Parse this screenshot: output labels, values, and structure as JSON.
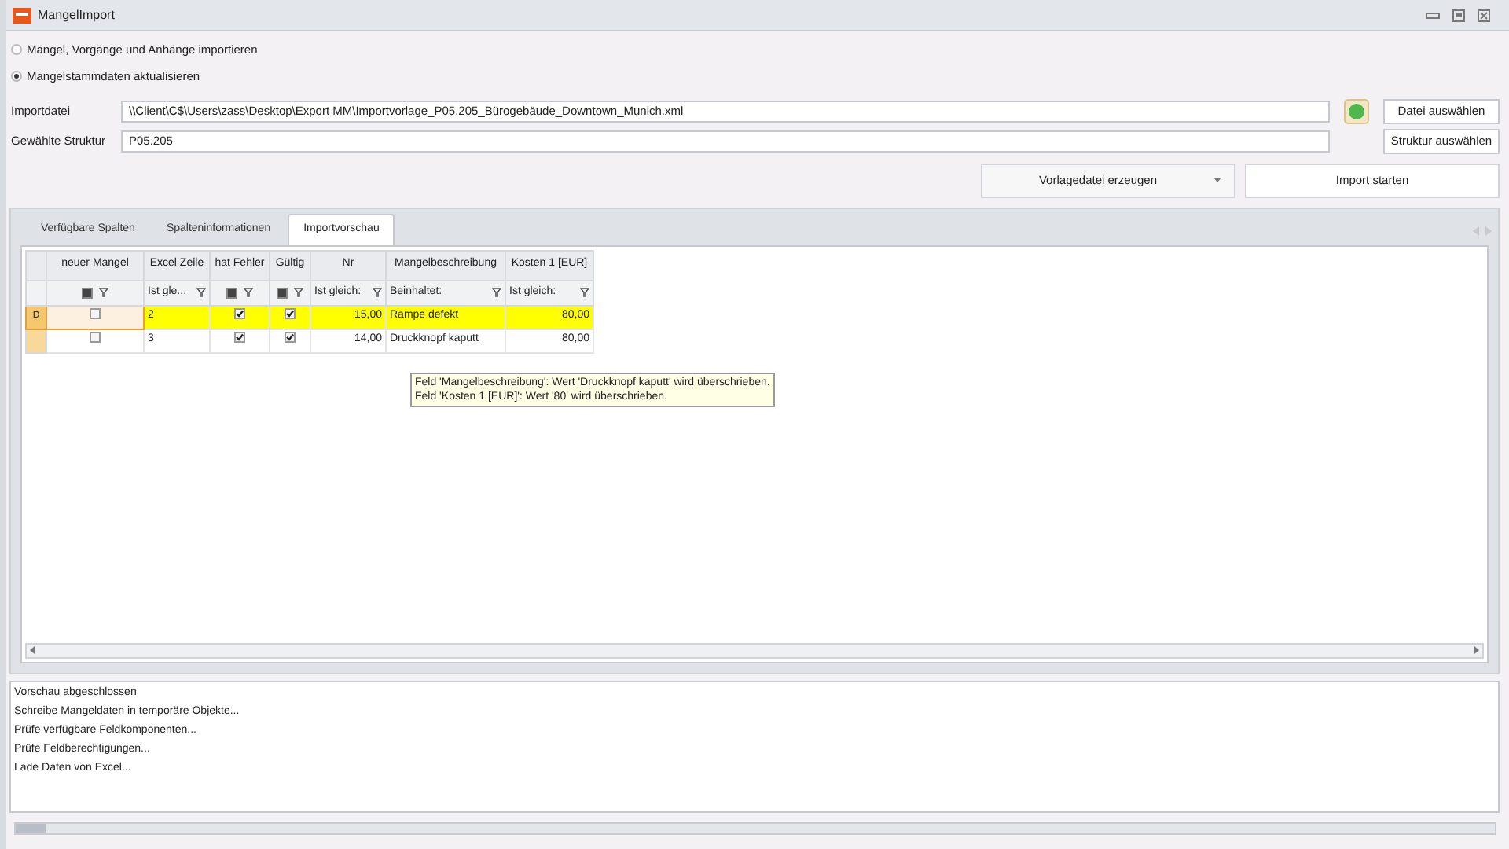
{
  "window": {
    "title": "MangelImport"
  },
  "modes": [
    {
      "label": "Mängel, Vorgänge und Anhänge importieren",
      "selected": false
    },
    {
      "label": "Mangelstammdaten aktualisieren",
      "selected": true
    }
  ],
  "import_file": {
    "label": "Importdatei",
    "value": "\\\\Client\\C$\\Users\\zass\\Desktop\\Export MM\\Importvorlage_P05.205_Bürogebäude_Downtown_Munich.xml",
    "button": "Datei auswählen"
  },
  "structure": {
    "label": "Gewählte Struktur",
    "value": "P05.205",
    "button": "Struktur auswählen"
  },
  "actions": {
    "template_button": "Vorlagedatei erzeugen",
    "import_button": "Import starten"
  },
  "tabs": [
    {
      "label": "Verfügbare Spalten",
      "selected": false
    },
    {
      "label": "Spalteninformationen",
      "selected": false
    },
    {
      "label": "Importvorschau",
      "selected": true
    }
  ],
  "table": {
    "columns": [
      {
        "label": "neuer Mangel",
        "kind": "check",
        "filter_on": true
      },
      {
        "label": "Excel Zeile",
        "kind": "text",
        "filter": "Ist gle..."
      },
      {
        "label": "hat Fehler",
        "kind": "check",
        "filter_on": true
      },
      {
        "label": "Gültig",
        "kind": "check",
        "filter_on": true
      },
      {
        "label": "Nr",
        "kind": "num",
        "filter": "Ist gleich:"
      },
      {
        "label": "Mangelbeschreibung",
        "kind": "text",
        "filter": "Beinhaltet:"
      },
      {
        "label": "Kosten 1 [EUR]",
        "kind": "num",
        "filter": "Ist gleich:"
      }
    ],
    "rows": [
      {
        "selected": true,
        "indicator": "D",
        "cells": [
          false,
          "2",
          true,
          true,
          "15,00",
          "Rampe defekt",
          "80,00"
        ]
      },
      {
        "selected": false,
        "cells": [
          false,
          "3",
          true,
          true,
          "14,00",
          "Druckknopf kaputt",
          "80,00"
        ]
      }
    ]
  },
  "tooltip": [
    "Feld 'Mangelbeschreibung': Wert 'Druckknopf kaputt' wird überschrieben.",
    "Feld 'Kosten 1 [EUR]': Wert '80' wird überschrieben."
  ],
  "progress": {
    "level": 0.02
  },
  "log": [
    "Vorschau abgeschlossen",
    "Schreibe Mangeldaten in temporäre Objekte...",
    "Prüfe verfügbare Feldkomponenten...",
    "Prüfe Feldberechtigungen...",
    "Lade Daten von Excel..."
  ]
}
